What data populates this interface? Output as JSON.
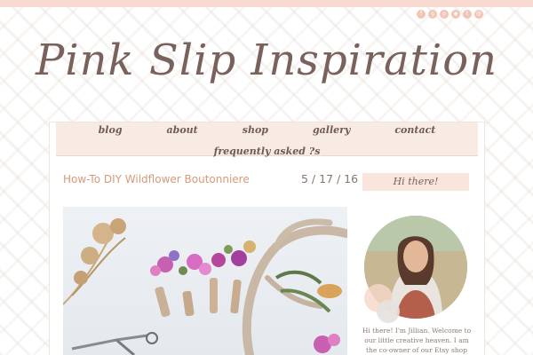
{
  "site": {
    "title": "Pink Slip Inspiration",
    "accent": "#f1c4b6",
    "text_color": "#7a625c"
  },
  "social": [
    {
      "icon": "facebook-icon",
      "glyph": "f"
    },
    {
      "icon": "google-plus-icon",
      "glyph": "g"
    },
    {
      "icon": "pinterest-icon",
      "glyph": "p"
    },
    {
      "icon": "instagram-icon",
      "glyph": "◉"
    },
    {
      "icon": "twitter-icon",
      "glyph": "t"
    },
    {
      "icon": "email-icon",
      "glyph": "@"
    }
  ],
  "nav": {
    "items": [
      "blog",
      "about",
      "shop",
      "gallery",
      "contact"
    ],
    "faq": "frequently asked ?s"
  },
  "post": {
    "title": "How-To DIY Wildflower Boutonniere",
    "date": "5 / 17 / 16"
  },
  "sidebar": {
    "heading": "Hi there!",
    "intro": "Hi there! I'm Jillian. Welcome to our little creative heaven. I am the co-owner of our Etsy shop Pink Slip"
  }
}
